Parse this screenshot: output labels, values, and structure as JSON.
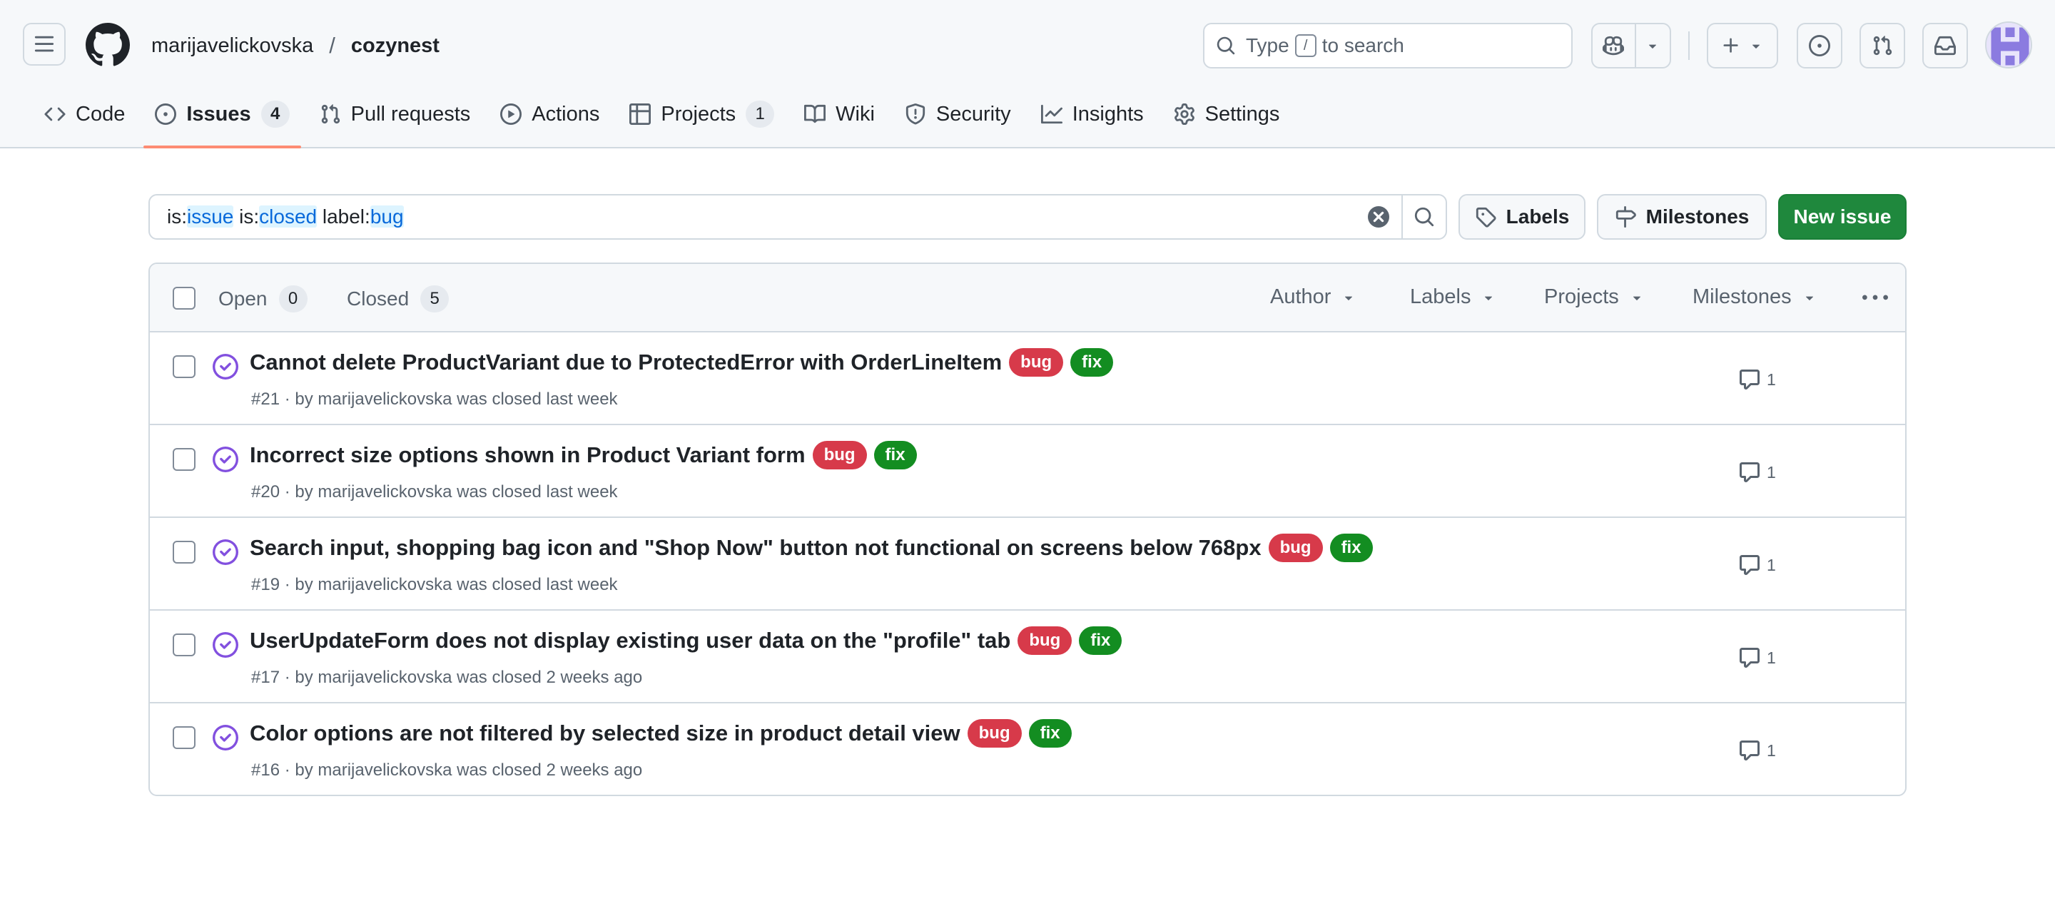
{
  "header": {
    "owner": "marijavelickovska",
    "separator": "/",
    "repo": "cozynest",
    "search_prefix": "Type",
    "search_key": "/",
    "search_suffix": "to search"
  },
  "nav": {
    "items": [
      {
        "label": "Code",
        "icon": "code-icon"
      },
      {
        "label": "Issues",
        "icon": "issue-opened-icon",
        "count": "4",
        "selected": true
      },
      {
        "label": "Pull requests",
        "icon": "git-pull-request-icon"
      },
      {
        "label": "Actions",
        "icon": "play-icon"
      },
      {
        "label": "Projects",
        "icon": "table-icon",
        "count": "1"
      },
      {
        "label": "Wiki",
        "icon": "book-icon"
      },
      {
        "label": "Security",
        "icon": "shield-icon"
      },
      {
        "label": "Insights",
        "icon": "graph-icon"
      },
      {
        "label": "Settings",
        "icon": "gear-icon"
      }
    ]
  },
  "filter": {
    "query_parts": [
      "is:",
      "issue",
      " is:",
      "closed",
      " label:",
      "bug"
    ],
    "labels_button": "Labels",
    "milestones_button": "Milestones",
    "new_issue_button": "New issue"
  },
  "list_header": {
    "open_label": "Open",
    "open_count": "0",
    "closed_label": "Closed",
    "closed_count": "5",
    "filters": [
      "Author",
      "Labels",
      "Projects",
      "Milestones"
    ]
  },
  "issues": [
    {
      "title": "Cannot delete ProductVariant due to ProtectedError with OrderLineItem",
      "labels": [
        "bug",
        "fix"
      ],
      "meta": "#21 · by marijavelickovska was closed last week",
      "comments": "1"
    },
    {
      "title": "Incorrect size options shown in Product Variant form",
      "labels": [
        "bug",
        "fix"
      ],
      "meta": "#20 · by marijavelickovska was closed last week",
      "comments": "1"
    },
    {
      "title": "Search input, shopping bag icon and \"Shop Now\" button not functional on screens below 768px",
      "labels": [
        "bug",
        "fix"
      ],
      "meta": "#19 · by marijavelickovska was closed last week",
      "comments": "1"
    },
    {
      "title": "UserUpdateForm does not display existing user data on the \"profile\" tab",
      "labels": [
        "bug",
        "fix"
      ],
      "meta": "#17 · by marijavelickovska was closed 2 weeks ago",
      "comments": "1"
    },
    {
      "title": "Color options are not filtered by selected size in product detail view",
      "labels": [
        "bug",
        "fix"
      ],
      "meta": "#16 · by marijavelickovska was closed 2 weeks ago",
      "comments": "1"
    }
  ],
  "colors": {
    "bug_label": "#d73a4a",
    "fix_label": "#138d21",
    "closed_state": "#8250df",
    "new_issue_button": "#1f883d",
    "selected_tab_underline": "#fd8c73"
  }
}
